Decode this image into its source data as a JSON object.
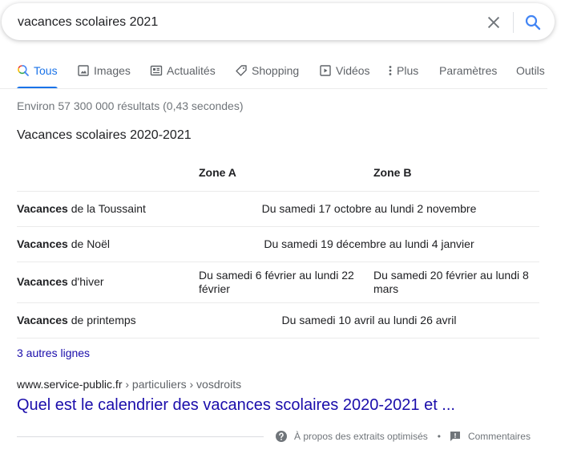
{
  "search": {
    "query": "vacances scolaires 2021",
    "clear_icon": "close-icon",
    "submit_icon": "search-icon"
  },
  "tabs": [
    {
      "label": "Tous",
      "icon": "search-icon",
      "active": true
    },
    {
      "label": "Images",
      "icon": "image-icon",
      "active": false
    },
    {
      "label": "Actualités",
      "icon": "news-icon",
      "active": false
    },
    {
      "label": "Shopping",
      "icon": "tag-icon",
      "active": false
    },
    {
      "label": "Vidéos",
      "icon": "play-icon",
      "active": false
    },
    {
      "label": "Plus",
      "icon": "more-vert-icon",
      "active": false
    },
    {
      "label": "Paramètres",
      "active": false
    },
    {
      "label": "Outils",
      "active": false
    }
  ],
  "stats": "Environ 57 300 000 résultats (0,43 secondes)",
  "snippet": {
    "title": "Vacances scolaires 2020-2021",
    "columns": [
      "",
      "Zone A",
      "Zone B"
    ],
    "rows": [
      {
        "label_bold": "Vacances",
        "label_rest": " de la Toussaint",
        "both": "Du samedi 17 octobre au lundi 2 novembre"
      },
      {
        "label_bold": "Vacances",
        "label_rest": " de Noël",
        "both": "Du samedi 19 décembre au lundi 4 janvier"
      },
      {
        "label_bold": "Vacances",
        "label_rest": " d'hiver",
        "zone_a": "Du samedi 6 février au lundi 22 février",
        "zone_b": "Du samedi 20 février au lundi 8 mars"
      },
      {
        "label_bold": "Vacances",
        "label_rest": " de printemps",
        "both": "Du samedi 10 avril au lundi 26 avril"
      }
    ],
    "more_rows": "3 autres lignes"
  },
  "result": {
    "domain": "www.service-public.fr",
    "breadcrumbs": " › particuliers › vosdroits",
    "title": "Quel est le calendrier des vacances scolaires 2020-2021 et ..."
  },
  "footer": {
    "about_label": "À propos des extraits optimisés",
    "about_icon": "help-circle-icon",
    "separator": "•",
    "feedback_label": "Commentaires",
    "feedback_icon": "feedback-icon"
  },
  "colors": {
    "accent": "#1a73e8",
    "link": "#1a0dab",
    "muted": "#70757a",
    "tab_text": "#5f6368"
  }
}
